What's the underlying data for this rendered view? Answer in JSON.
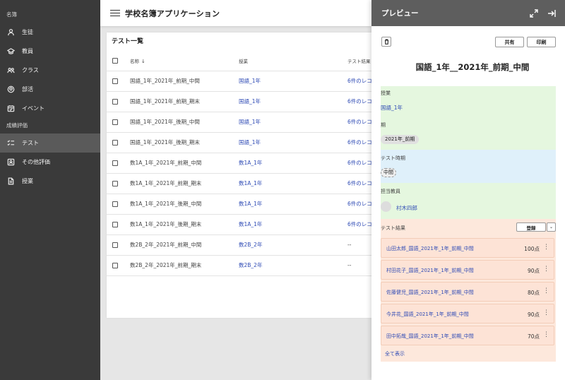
{
  "sidebar": {
    "sections": [
      {
        "label": "名簿",
        "items": [
          {
            "label": "生徒",
            "icon": "person-icon"
          },
          {
            "label": "教員",
            "icon": "school-icon"
          },
          {
            "label": "クラス",
            "icon": "group-icon"
          },
          {
            "label": "部活",
            "icon": "ball-icon"
          },
          {
            "label": "イベント",
            "icon": "calendar-icon"
          }
        ]
      },
      {
        "label": "成績評価",
        "items": [
          {
            "label": "テスト",
            "icon": "checklist-icon",
            "active": true
          },
          {
            "label": "その他評価",
            "icon": "badge-icon"
          },
          {
            "label": "授業",
            "icon": "document-icon"
          }
        ]
      }
    ]
  },
  "topbar": {
    "title": "学校名簿アプリケーション"
  },
  "list": {
    "title": "テスト一覧",
    "columns": [
      "名称",
      "授業",
      "テスト結果"
    ],
    "rows": [
      {
        "name": "国語_1年_2021年_前期_中間",
        "class": "国語_1年",
        "result": "6件のレコ"
      },
      {
        "name": "国語_1年_2021年_前期_期末",
        "class": "国語_1年",
        "result": "6件のレコ"
      },
      {
        "name": "国語_1年_2021年_後期_中間",
        "class": "国語_1年",
        "result": "6件のレコ"
      },
      {
        "name": "国語_1年_2021年_後期_期末",
        "class": "国語_1年",
        "result": "6件のレコ"
      },
      {
        "name": "数1A_1年_2021年_前期_中間",
        "class": "数1A_1年",
        "result": "6件のレコ"
      },
      {
        "name": "数1A_1年_2021年_前期_期末",
        "class": "数1A_1年",
        "result": "6件のレコ"
      },
      {
        "name": "数1A_1年_2021年_後期_中間",
        "class": "数1A_1年",
        "result": "6件のレコ"
      },
      {
        "name": "数1A_1年_2021年_後期_期末",
        "class": "数1A_1年",
        "result": "6件のレコ"
      },
      {
        "name": "数2B_2年_2021年_前期_中間",
        "class": "数2B_2年",
        "result": "--"
      },
      {
        "name": "数2B_2年_2021年_前期_期末",
        "class": "数2B_2年",
        "result": "--"
      }
    ]
  },
  "preview": {
    "header_title": "プレビュー",
    "share_label": "共有",
    "print_label": "印刷",
    "doc_title": "国語_1年__2021年_前期_中間",
    "class_label": "授業",
    "class_value": "国語_1年",
    "term_label": "期",
    "term_value": "2021年_前期",
    "timing_label": "テスト時期",
    "timing_value": "中間",
    "teacher_label": "担当教員",
    "teacher_value": "村木四郎",
    "results_label": "テスト結果",
    "register_label": "登録",
    "results": [
      {
        "name": "山田太郎_国語_2021年_1年_前期_中間",
        "score": "100点"
      },
      {
        "name": "村田花子_国語_2021年_1年_前期_中間",
        "score": "90点"
      },
      {
        "name": "佐藤健児_国語_2021年_1年_前期_中間",
        "score": "80点"
      },
      {
        "name": "今井花_国語_2021年_1年_前期_中間",
        "score": "90点"
      },
      {
        "name": "田中拓哉_国語_2021年_1年_前期_中間",
        "score": "70点"
      }
    ],
    "show_all_label": "全て表示"
  }
}
